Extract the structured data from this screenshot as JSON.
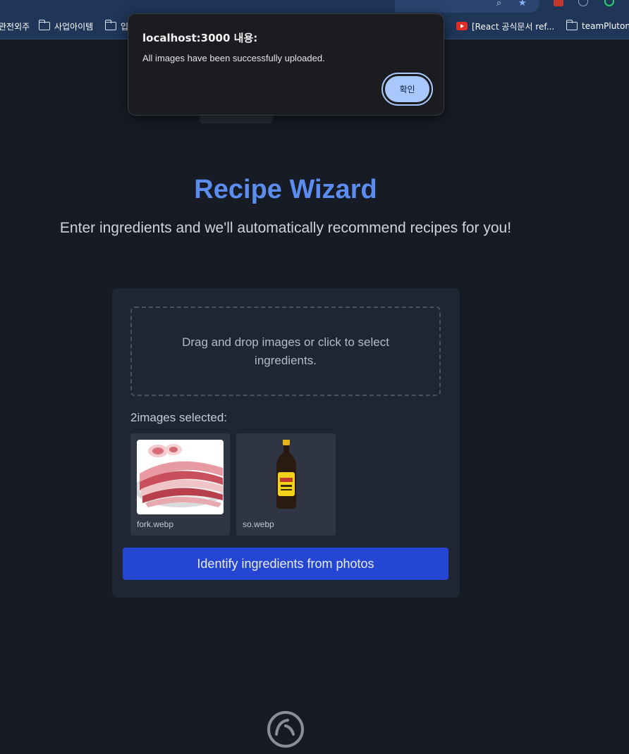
{
  "browser": {
    "bookmarks": [
      {
        "type": "text",
        "label": "관전외주"
      },
      {
        "type": "folder",
        "label": "사업아이템"
      },
      {
        "type": "folder",
        "label": "입"
      },
      {
        "type": "youtube",
        "label": "[React 공식문서 ref..."
      },
      {
        "type": "folder",
        "label": "teamPluton"
      }
    ],
    "icons": [
      "search-icon",
      "star-icon",
      "extension-icon",
      "profile-icon",
      "sync-icon"
    ]
  },
  "page": {
    "title": "Recipe Wizard",
    "subtitle": "Enter ingredients and we'll automatically recommend recipes for you!"
  },
  "upload": {
    "dropzone_text": "Drag and drop images or click to select ingredients.",
    "selected_label": "2images selected:",
    "files": [
      {
        "name": "fork.webp",
        "depicts": "raw pork belly slices"
      },
      {
        "name": "so.webp",
        "depicts": "soy sauce bottle"
      }
    ],
    "identify_button": "Identify ingredients from photos"
  },
  "alert": {
    "title": "localhost:3000 내용:",
    "message": "All images have been successfully uploaded.",
    "ok_label": "확인"
  },
  "colors": {
    "background": "#161b26",
    "accent": "#5b8def",
    "button": "#2446d3",
    "card": "#202533",
    "dialog_button": "#a8c7fa"
  }
}
